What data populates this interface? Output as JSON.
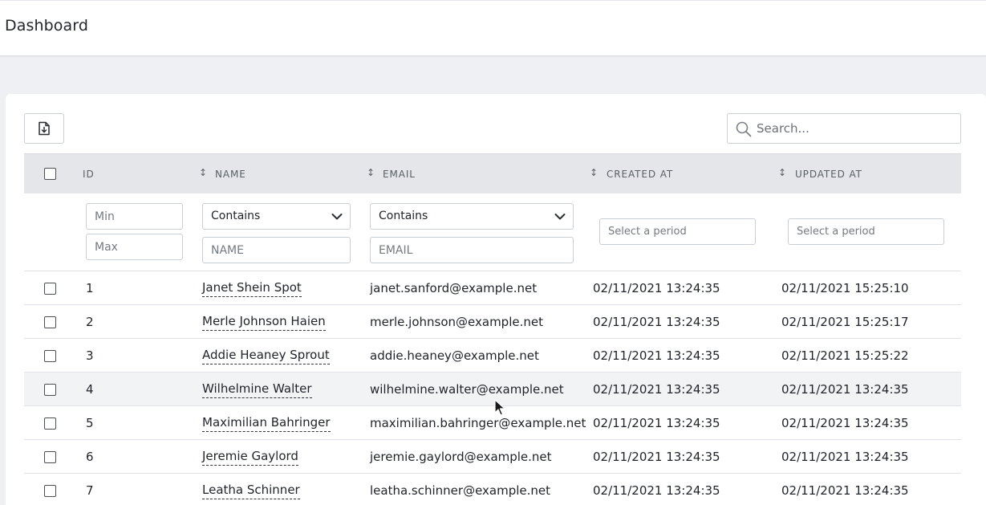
{
  "header": {
    "title": "Dashboard"
  },
  "toolbar": {
    "export_icon": "file-download-icon",
    "search_placeholder": "Search...",
    "search_icon": "search-icon"
  },
  "table": {
    "columns": {
      "id": "ID",
      "name": "NAME",
      "email": "EMAIL",
      "created_at": "CREATED AT",
      "updated_at": "UPDATED AT"
    },
    "filters": {
      "id_min_placeholder": "Min",
      "id_max_placeholder": "Max",
      "name_operator": "Contains",
      "name_placeholder": "NAME",
      "email_operator": "Contains",
      "email_placeholder": "EMAIL",
      "created_placeholder": "Select a period",
      "updated_placeholder": "Select a period"
    },
    "rows": [
      {
        "id": "1",
        "name": "Janet Shein Spot",
        "email": "janet.sanford@example.net",
        "created": "02/11/2021 13:24:35",
        "updated": "02/11/2021 15:25:10"
      },
      {
        "id": "2",
        "name": "Merle Johnson Haien",
        "email": "merle.johnson@example.net",
        "created": "02/11/2021 13:24:35",
        "updated": "02/11/2021 15:25:17"
      },
      {
        "id": "3",
        "name": "Addie Heaney Sprout",
        "email": "addie.heaney@example.net",
        "created": "02/11/2021 13:24:35",
        "updated": "02/11/2021 15:25:22"
      },
      {
        "id": "4",
        "name": "Wilhelmine Walter",
        "email": "wilhelmine.walter@example.net",
        "created": "02/11/2021 13:24:35",
        "updated": "02/11/2021 13:24:35"
      },
      {
        "id": "5",
        "name": "Maximilian Bahringer",
        "email": "maximilian.bahringer@example.net",
        "created": "02/11/2021 13:24:35",
        "updated": "02/11/2021 13:24:35"
      },
      {
        "id": "6",
        "name": "Jeremie Gaylord",
        "email": "jeremie.gaylord@example.net",
        "created": "02/11/2021 13:24:35",
        "updated": "02/11/2021 13:24:35"
      },
      {
        "id": "7",
        "name": "Leatha Schinner",
        "email": "leatha.schinner@example.net",
        "created": "02/11/2021 13:24:35",
        "updated": "02/11/2021 13:24:35"
      }
    ]
  }
}
